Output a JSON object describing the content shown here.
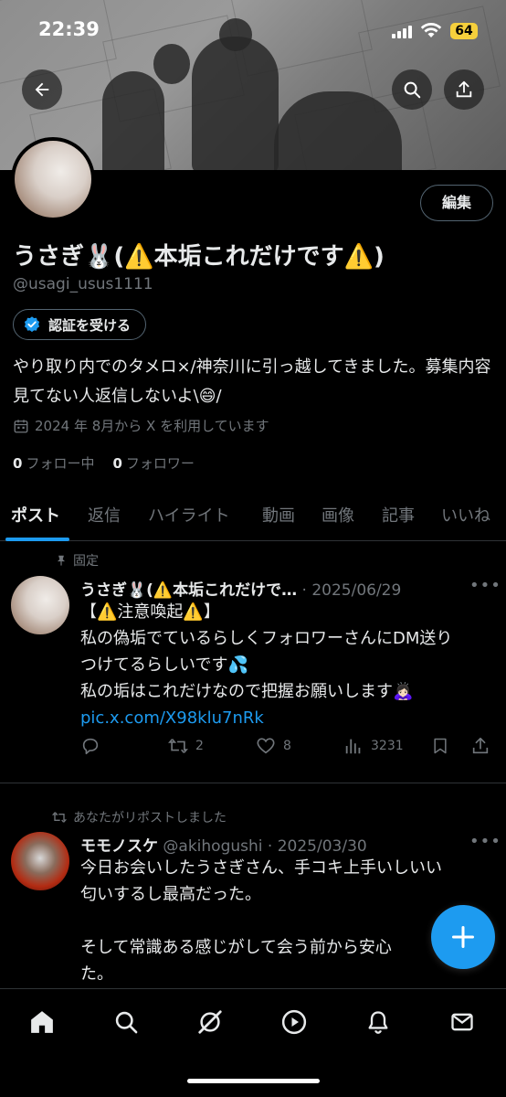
{
  "status": {
    "time": "22:39",
    "battery": "64"
  },
  "profile": {
    "display_name": "うさぎ🐰(⚠️本垢これだけです⚠️)",
    "handle": "@usagi_usus1111",
    "edit_label": "編集",
    "verify_label": "認証を受ける",
    "bio": "やり取り内でのタメロ×/神奈川に引っ越してきました。募集内容見てない人返信しないよ\\😄/",
    "joined": "2024 年 8月から X を利用しています",
    "following_count": "0",
    "following_label": "フォロー中",
    "followers_count": "0",
    "followers_label": "フォロワー"
  },
  "tabs": [
    "ポスト",
    "返信",
    "ハイライト",
    "動画",
    "画像",
    "記事",
    "いいね"
  ],
  "posts": [
    {
      "context": "固定",
      "name": "うさぎ🐰(⚠️本垢これだけで…",
      "date": "2025/06/29",
      "lines": [
        "【⚠️注意喚起⚠️】",
        "私の偽垢でているらしくフォロワーさんにDM送り",
        "つけてるらしいです💦",
        "私の垢はこれだけなので把握お願いします🙇🏻‍♀️"
      ],
      "link": "pic.x.com/X98klu7nRk",
      "reposts": "2",
      "likes": "8",
      "views": "3231"
    },
    {
      "context": "あなたがリポストしました",
      "name": "モモノスケ",
      "handle": "@akihogushi",
      "date": "2025/03/30",
      "lines": [
        "今日お会いしたうさぎさん、手コキ上手いしいい",
        "匂いするし最高だった。",
        "",
        "そして常識ある感じがして会う前から安心",
        "た。"
      ]
    }
  ],
  "icons": {
    "back": "back-arrow-icon",
    "search": "search-icon",
    "share": "share-icon",
    "verified": "verified-badge-icon",
    "calendar": "calendar-icon",
    "pin": "pin-icon",
    "reply": "reply-icon",
    "repost": "repost-icon",
    "like": "heart-icon",
    "views": "views-icon",
    "bookmark": "bookmark-icon",
    "compose": "plus-icon"
  },
  "colors": {
    "accent": "#1d9bf0",
    "background": "#000000",
    "muted": "#71767b"
  }
}
